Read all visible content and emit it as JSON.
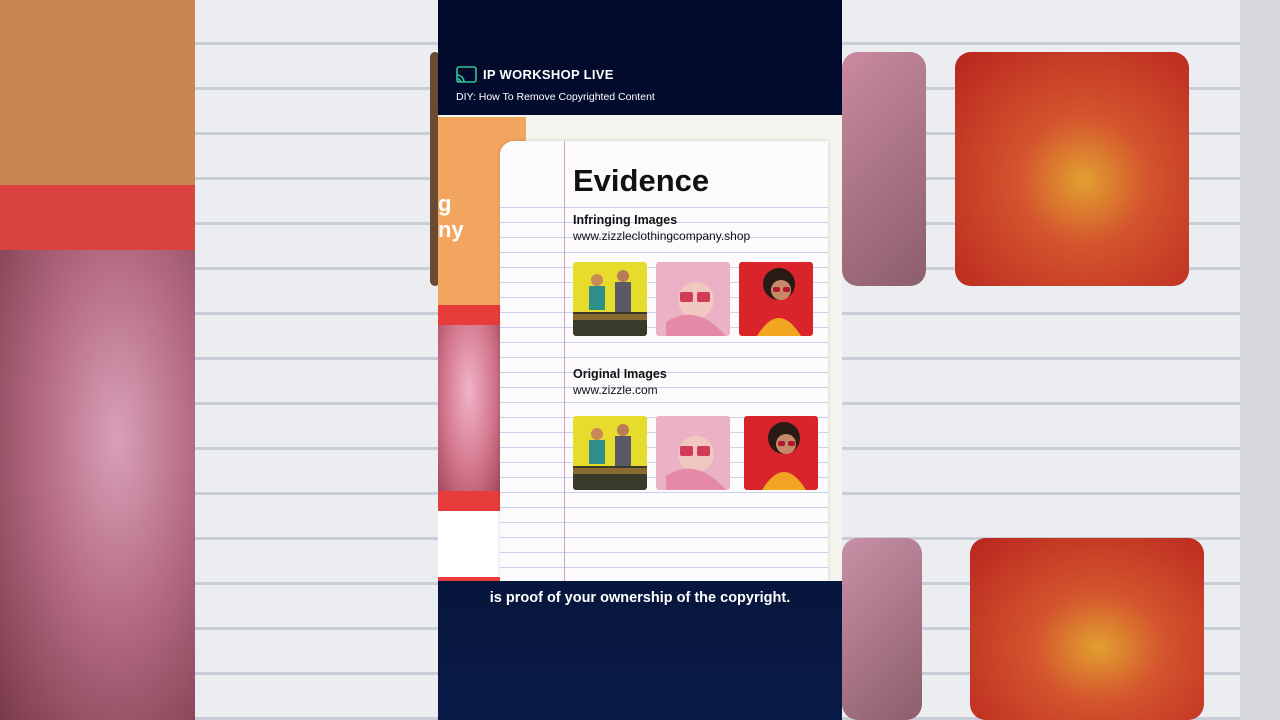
{
  "video": {
    "brand_title": "IP WORKSHOP LIVE",
    "brand_icon": "cast-icon",
    "subtitle": "DIY: How To Remove Copyrighted Content",
    "caption": "is proof of your ownership of the copyright."
  },
  "slide": {
    "side_text_line1": "g",
    "side_text_line2": "ny",
    "title": "Evidence",
    "infringing": {
      "label": "Infringing Images",
      "url": "www.zizzleclothingcompany.shop",
      "images": [
        "two-people-yellow-photo",
        "pink-sunglasses-woman-photo",
        "red-sunglasses-woman-photo"
      ]
    },
    "original": {
      "label": "Original Images",
      "url": "www.zizzle.com",
      "images": [
        "two-people-yellow-photo",
        "pink-sunglasses-woman-photo",
        "red-sunglasses-woman-photo"
      ]
    }
  },
  "colors": {
    "panel_bg": "#020a2c",
    "accent_orange": "#f2a55e",
    "accent_red": "#e83c3c",
    "cast_icon": "#34c29a"
  }
}
